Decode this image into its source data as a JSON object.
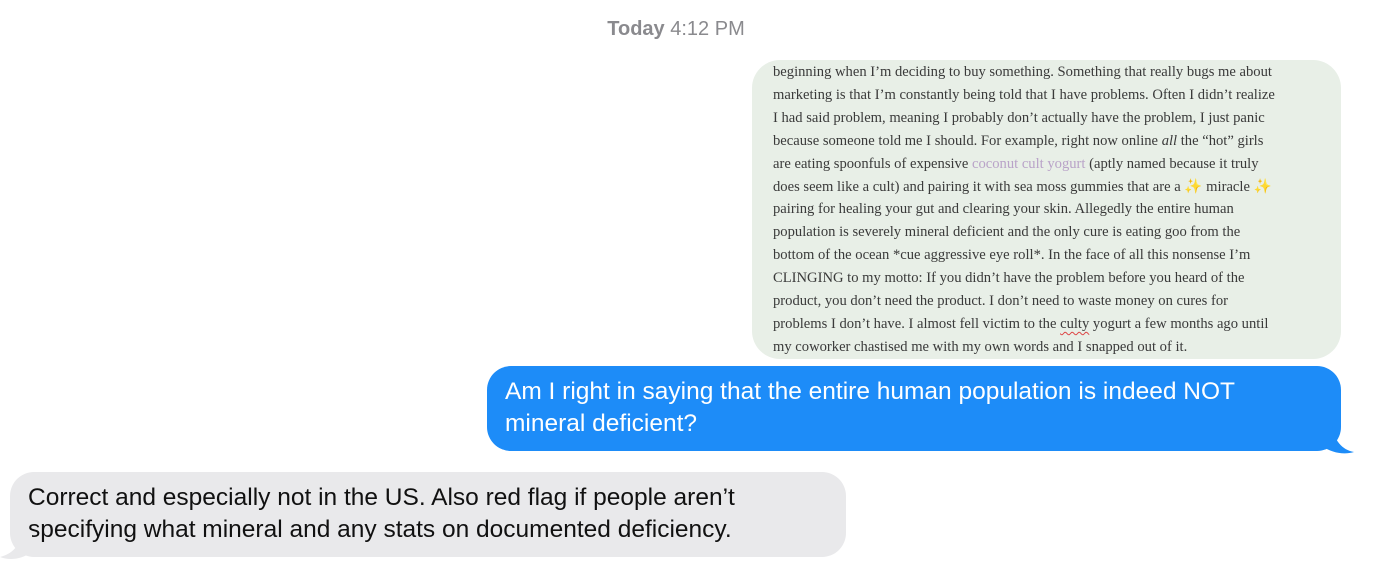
{
  "timestamp": {
    "day": "Today",
    "time": "4:12 PM"
  },
  "screenshot_message": {
    "lines": [
      {
        "parts": [
          {
            "text": "beginning when I’m deciding to buy something. Something that really bugs me about"
          }
        ]
      },
      {
        "parts": [
          {
            "text": "marketing is that I’m constantly being told that I have problems. Often I didn’t realize"
          }
        ]
      },
      {
        "parts": [
          {
            "text": "I had said problem, meaning I probably don’t actually have the problem, I just panic"
          }
        ]
      },
      {
        "parts": [
          {
            "text": "because someone told me I should. For example, right now online "
          },
          {
            "text": "all",
            "style": "em"
          },
          {
            "text": " the “hot” girls"
          }
        ]
      },
      {
        "parts": [
          {
            "text": "are eating spoonfuls of expensive "
          },
          {
            "text": "coconut cult yogurt",
            "style": "link"
          },
          {
            "text": " (aptly named because it truly"
          }
        ]
      },
      {
        "parts": [
          {
            "text": "does seem like a cult) and pairing it with sea moss gummies that are a "
          },
          {
            "text": "✨",
            "style": "spark"
          },
          {
            "text": " miracle "
          },
          {
            "text": "✨",
            "style": "spark"
          }
        ]
      },
      {
        "parts": [
          {
            "text": "pairing for healing your gut and clearing your skin. Allegedly the entire human"
          }
        ]
      },
      {
        "parts": [
          {
            "text": "population is severely mineral deficient and the only cure is eating goo from the"
          }
        ]
      },
      {
        "parts": [
          {
            "text": "bottom of the ocean *cue aggressive eye roll*. In the face of all this nonsense I’m"
          }
        ]
      },
      {
        "parts": [
          {
            "text": "CLINGING to my motto: If you didn’t have the problem before you heard of the"
          }
        ]
      },
      {
        "parts": [
          {
            "text": "product, you don’t need the product. I don’t need to waste money on cures for"
          }
        ]
      },
      {
        "parts": [
          {
            "text": "problems I don’t have. I almost fell victim to the "
          },
          {
            "text": "culty",
            "style": "squig"
          },
          {
            "text": " yogurt a few months ago until"
          }
        ]
      },
      {
        "parts": [
          {
            "text": "my coworker chastised me with my own words and I snapped out of it."
          }
        ]
      }
    ]
  },
  "sent_message": {
    "line1": "Am I right in saying that the entire human population is indeed NOT",
    "line2": "mineral deficient?"
  },
  "received_message": {
    "line1": "Correct and especially not in the US. Also red flag if people aren’t",
    "line2": "specifying what mineral and any stats on documented deficiency."
  },
  "colors": {
    "sent_bubble": "#1d8cf8",
    "received_bubble": "#e9e9eb",
    "screenshot_bubble": "#e8efe7",
    "timestamp": "#8a8a8e"
  }
}
